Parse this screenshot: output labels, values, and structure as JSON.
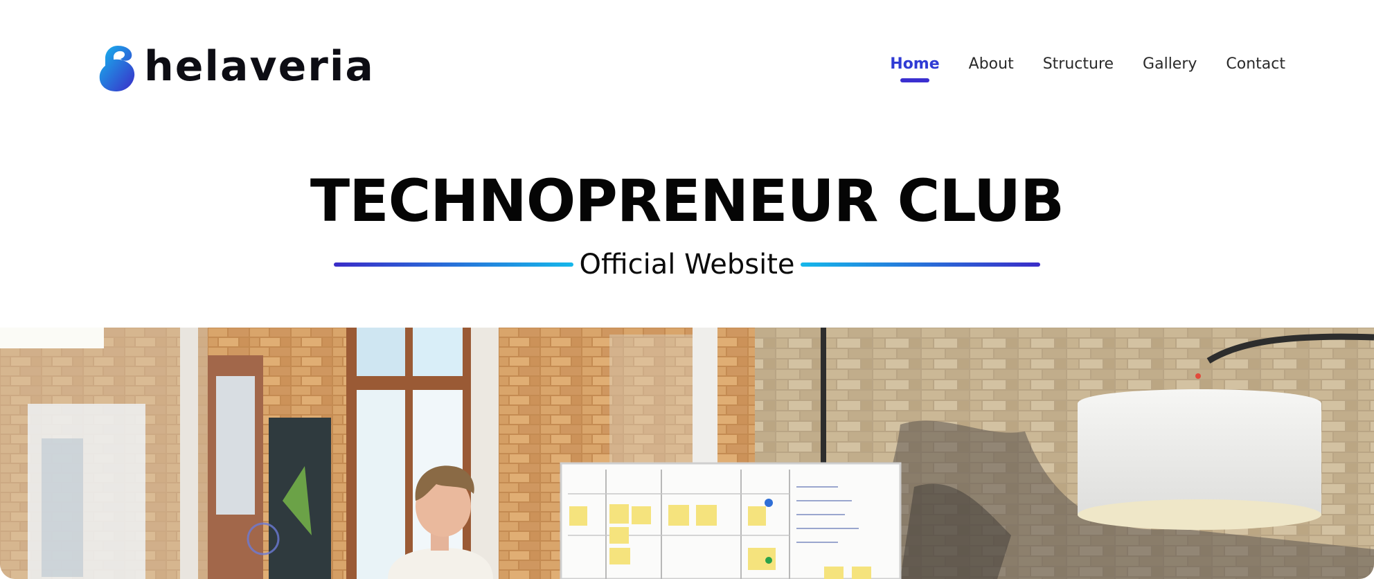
{
  "brand": {
    "name": "helaveria",
    "logo_colors": [
      "#2f3bd4",
      "#16b9ef"
    ]
  },
  "nav": {
    "items": [
      {
        "label": "Home",
        "active": true
      },
      {
        "label": "About",
        "active": false
      },
      {
        "label": "Structure",
        "active": false
      },
      {
        "label": "Gallery",
        "active": false
      },
      {
        "label": "Contact",
        "active": false
      }
    ],
    "active_color": "#2f3bd4"
  },
  "hero": {
    "title": "TECHNOPRENEUR CLUB",
    "subtitle": "Official Website",
    "accent_gradient": [
      "#3a2cc8",
      "#15b7ea"
    ],
    "photo_icon": "office-whiteboard-photo"
  }
}
